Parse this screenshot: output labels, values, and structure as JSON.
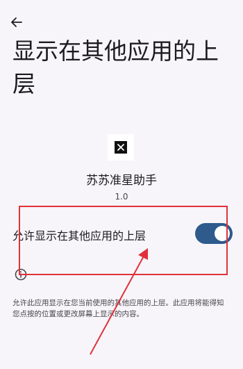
{
  "header": {
    "back_icon": "arrow-back-icon"
  },
  "page": {
    "title": "显示在其他应用的上层"
  },
  "app": {
    "icon": "app-x-icon",
    "name": "苏苏准星助手",
    "version": "1.0"
  },
  "setting": {
    "label": "允许显示在其他应用的上层",
    "enabled": true,
    "accent": "#2e5a8c"
  },
  "info": {
    "icon": "info-icon",
    "description": "允许此应用显示在您当前使用的其他应用的上层。此应用将能得知您点按的位置或更改屏幕上显示的内容。"
  },
  "annotation": {
    "color": "#e0313a"
  }
}
